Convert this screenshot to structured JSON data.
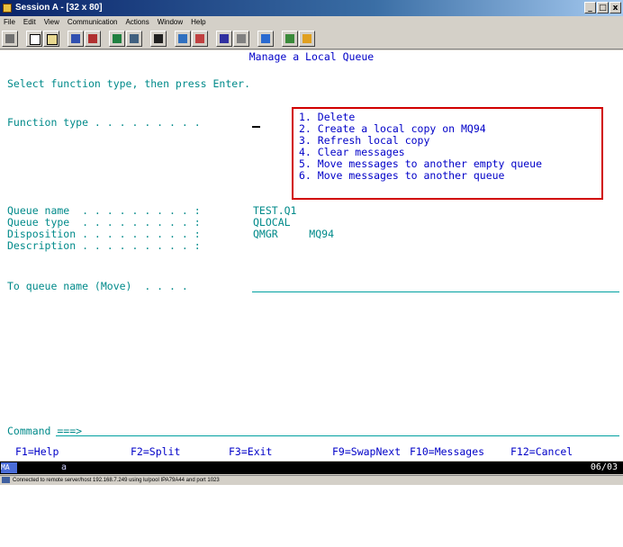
{
  "window": {
    "title": "Session A - [32 x 80]",
    "controls": [
      "_",
      "□",
      "x"
    ]
  },
  "menu": [
    "File",
    "Edit",
    "View",
    "Communication",
    "Actions",
    "Window",
    "Help"
  ],
  "toolbar": {
    "buttons": [
      "print-icon",
      "copy-icon",
      "paste-icon",
      "send-icon",
      "receive-icon",
      "display-icon",
      "map-icon",
      "record-icon",
      "playback-icon",
      "macro-icon",
      "quickstart-icon",
      "customize-icon",
      "color-icon",
      "help-icon"
    ]
  },
  "screen": {
    "title": "Manage a Local Queue",
    "instruction": "Select function type, then press Enter.",
    "function_type_label": "Function type . . . . . . . . .",
    "options": [
      "1. Delete",
      "2. Create a local copy on MQ94",
      "3. Refresh local copy",
      "4. Clear messages",
      "5. Move messages to another empty queue",
      "6. Move messages to another queue"
    ],
    "fields": [
      {
        "label": "Queue name  . . . . . . . . . :",
        "value": "TEST.Q1"
      },
      {
        "label": "Queue type  . . . . . . . . . :",
        "value": "QLOCAL"
      },
      {
        "label": "Disposition . . . . . . . . . :",
        "value": "QMGR     MQ94"
      },
      {
        "label": "Description . . . . . . . . . :",
        "value": ""
      }
    ],
    "to_queue_label": "To queue name (Move)  . . . .",
    "to_queue_value": "",
    "command_label": "Command ===>",
    "command_value": "",
    "fkeys": [
      "F1=Help",
      "F2=Split",
      "F3=Exit",
      "F9=SwapNext",
      "F10=Messages",
      "F12=Cancel"
    ]
  },
  "status": {
    "indicator": "MA",
    "mode": "a",
    "right": "06/03"
  },
  "connection": {
    "text": "Connected to remote server/host 192.168.7.249 using lu/pool IPA79A44 and port 1023"
  },
  "colors": {
    "field_text": "#008a8a",
    "input_text": "#0000c8",
    "highlight_box": "#d10000",
    "title_bar": "#0a246a"
  }
}
